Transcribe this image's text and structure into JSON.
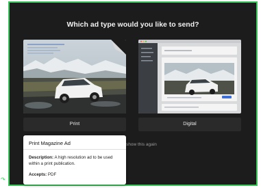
{
  "dialog": {
    "title": "Which ad type would you like to send?",
    "options": [
      {
        "label": "Print"
      },
      {
        "label": "Digital"
      }
    ],
    "dont_show_text": "show this again"
  },
  "tooltip": {
    "title": "Print Magazine Ad",
    "description_label": "Description:",
    "description_text": "A high resolution ad to be used within a print publication.",
    "accepts_label": "Accepts:",
    "accepts_value": "PDF"
  },
  "colors": {
    "accent_border": "#3ac85a",
    "modal_bg": "#1c1c1c",
    "button_bg": "#2a2a2a",
    "digital_highlight": "#3d6fd6"
  },
  "icons": {
    "side": "arrow-icon"
  }
}
